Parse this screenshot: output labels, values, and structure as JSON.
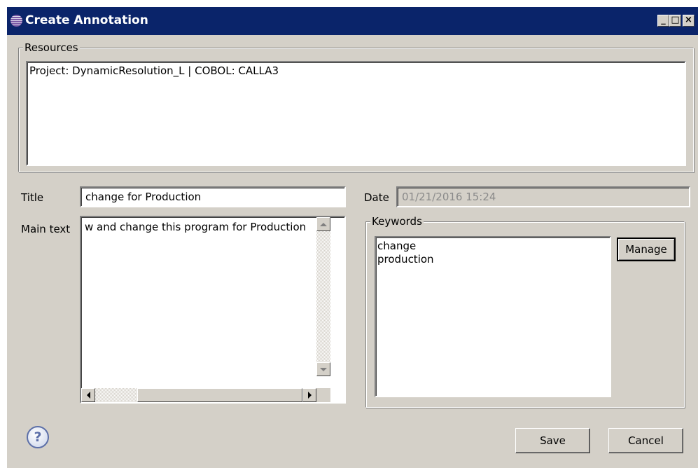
{
  "window": {
    "title": "Create Annotation",
    "controls": {
      "minimize": "_",
      "maximize": "□",
      "close": "×"
    }
  },
  "resources": {
    "legend": "Resources",
    "items": [
      "Project: DynamicResolution_L | COBOL: CALLA3"
    ]
  },
  "form": {
    "title_label": "Title",
    "title_value": "change for Production",
    "main_text_label": "Main text",
    "main_text_value": "w and change this program for Production",
    "date_label": "Date",
    "date_value": "01/21/2016 15:24"
  },
  "keywords": {
    "legend": "Keywords",
    "items": [
      "change",
      "production"
    ],
    "manage_label": "Manage"
  },
  "footer": {
    "help_glyph": "?",
    "save_label": "Save",
    "cancel_label": "Cancel"
  },
  "icons": {
    "app": "eclipse-icon",
    "help": "help-icon"
  }
}
